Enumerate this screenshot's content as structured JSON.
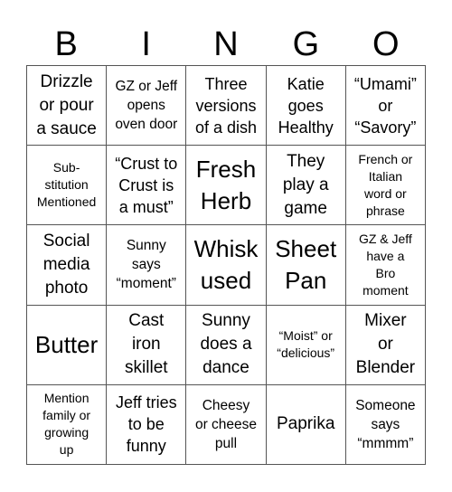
{
  "header": [
    "B",
    "I",
    "N",
    "G",
    "O"
  ],
  "cells": [
    {
      "text": "Drizzle\nor pour\na sauce",
      "size": "s19"
    },
    {
      "text": "GZ or Jeff\nopens\noven door",
      "size": "s15"
    },
    {
      "text": "Three\nversions\nof a dish",
      "size": "s18"
    },
    {
      "text": "Katie\ngoes\nHealthy",
      "size": "s18"
    },
    {
      "text": "“Umami”\nor\n“Savory”",
      "size": "s18"
    },
    {
      "text": "Sub-\nstitution\nMentioned",
      "size": "s13"
    },
    {
      "text": "“Crust to\nCrust is\na must”",
      "size": "s18"
    },
    {
      "text": "Fresh\nHerb",
      "size": "s26"
    },
    {
      "text": "They\nplay a\ngame",
      "size": "s19"
    },
    {
      "text": "French or\nItalian\nword or\nphrase",
      "size": "s13"
    },
    {
      "text": "Social\nmedia\nphoto",
      "size": "s19"
    },
    {
      "text": "Sunny\nsays\n“moment”",
      "size": "s15"
    },
    {
      "text": "Whisk\nused",
      "size": "s26"
    },
    {
      "text": "Sheet\nPan",
      "size": "s26"
    },
    {
      "text": "GZ & Jeff\nhave a\nBro\nmoment",
      "size": "s13"
    },
    {
      "text": "Butter",
      "size": "s26"
    },
    {
      "text": "Cast\niron\nskillet",
      "size": "s19"
    },
    {
      "text": "Sunny\ndoes a\ndance",
      "size": "s19"
    },
    {
      "text": "“Moist” or\n“delicious”",
      "size": "s13"
    },
    {
      "text": "Mixer\nor\nBlender",
      "size": "s19"
    },
    {
      "text": "Mention\nfamily or\ngrowing\nup",
      "size": "s13"
    },
    {
      "text": "Jeff tries\nto be\nfunny",
      "size": "s18"
    },
    {
      "text": "Cheesy\nor cheese\npull",
      "size": "s15"
    },
    {
      "text": "Paprika",
      "size": "s19"
    },
    {
      "text": "Someone\nsays\n“mmmm”",
      "size": "s15"
    }
  ]
}
